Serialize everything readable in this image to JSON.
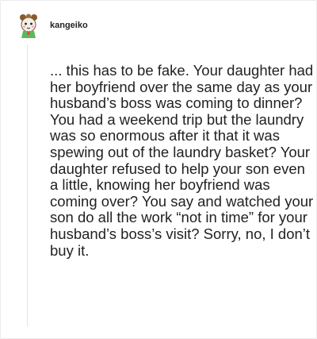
{
  "post": {
    "username": "kangeiko",
    "avatar_icon": "cartoon-character-avatar-icon",
    "body": "... this has to be fake. Your daughter had her boyfriend over the same day as your husband’s boss was coming to dinner? You had a weekend trip but the laundry was so enormous after it that it was spewing out of the laundry basket? Your daughter refused to help your son even a little, knowing her boyfriend was coming over? You say and watched your son do all the work “not in time” for your husband’s boss’s visit? Sorry, no, I don’t buy it."
  }
}
